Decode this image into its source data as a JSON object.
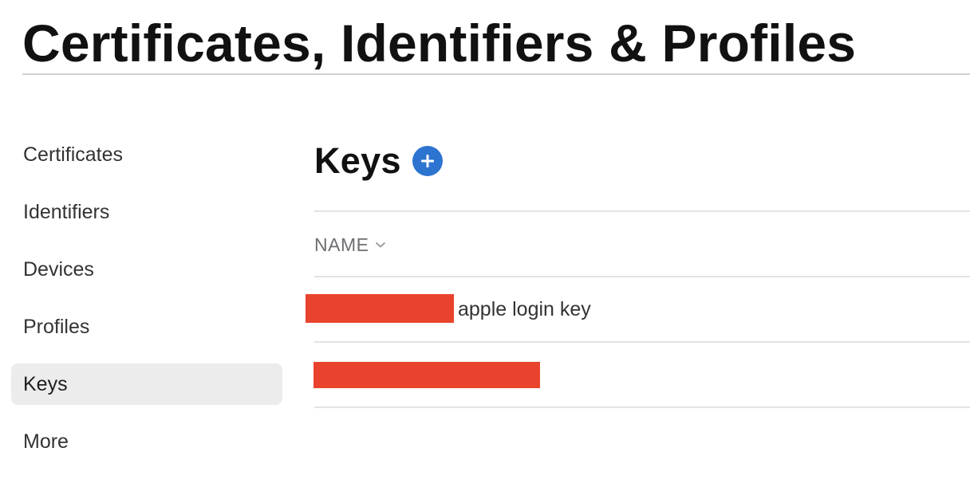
{
  "header": {
    "title": "Certificates, Identifiers & Profiles"
  },
  "sidebar": {
    "items": [
      {
        "label": "Certificates",
        "active": false
      },
      {
        "label": "Identifiers",
        "active": false
      },
      {
        "label": "Devices",
        "active": false
      },
      {
        "label": "Profiles",
        "active": false
      },
      {
        "label": "Keys",
        "active": true
      },
      {
        "label": "More",
        "active": false
      }
    ]
  },
  "main": {
    "section_title": "Keys",
    "add_icon": "plus-circle-icon",
    "table": {
      "column_header": "NAME",
      "sort_icon": "chevron-down-icon",
      "rows": [
        {
          "redacted": true,
          "name_suffix": "apple login key"
        },
        {
          "redacted": true,
          "name_suffix": ""
        }
      ]
    }
  },
  "colors": {
    "accent": "#2d74d0",
    "redaction": "#e9432d",
    "active_background": "#ececec"
  }
}
